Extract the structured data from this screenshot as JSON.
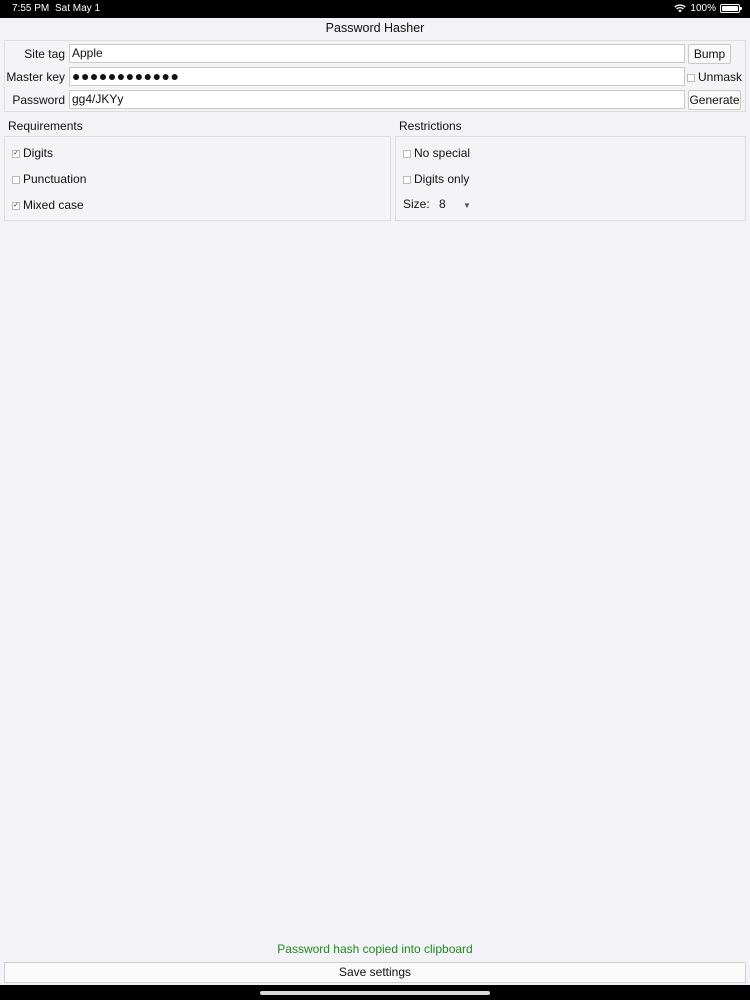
{
  "status_bar": {
    "time": "7:55 PM",
    "date": "Sat May 1",
    "battery": "100%"
  },
  "app": {
    "title": "Password Hasher"
  },
  "form": {
    "site_tag": {
      "label": "Site tag",
      "value": "Apple"
    },
    "master_key": {
      "label": "Master key",
      "value": "●●●●●●●●●●●●"
    },
    "password": {
      "label": "Password",
      "value": "gg4/JKYy"
    },
    "bump_label": "Bump",
    "unmask_label": "Unmask",
    "unmask_checked": false,
    "generate_label": "Generate"
  },
  "requirements": {
    "title": "Requirements",
    "items": [
      {
        "label": "Digits",
        "checked": true
      },
      {
        "label": "Punctuation",
        "checked": false
      },
      {
        "label": "Mixed case",
        "checked": true
      }
    ]
  },
  "restrictions": {
    "title": "Restrictions",
    "items": [
      {
        "label": "No special",
        "checked": false
      },
      {
        "label": "Digits only",
        "checked": false
      }
    ],
    "size_label": "Size:",
    "size_value": "8"
  },
  "message": "Password hash copied into clipboard",
  "save_label": "Save settings"
}
